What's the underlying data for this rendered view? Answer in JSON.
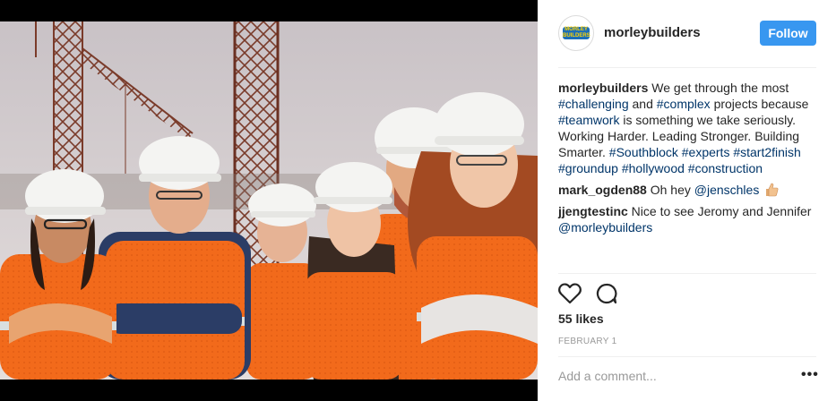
{
  "account": {
    "handle": "morleybuilders",
    "logo_text": "MORLEY BUILDERS"
  },
  "header": {
    "follow_label": "Follow"
  },
  "caption": {
    "user": "morleybuilders",
    "segments": [
      {
        "text": " We get through the most ",
        "type": "text"
      },
      {
        "text": "#challenging",
        "type": "tag"
      },
      {
        "text": " and ",
        "type": "text"
      },
      {
        "text": "#complex",
        "type": "tag"
      },
      {
        "text": " projects because ",
        "type": "text"
      },
      {
        "text": "#teamwork",
        "type": "tag"
      },
      {
        "text": " is something we take seriously.",
        "type": "text"
      },
      {
        "text": "\n",
        "type": "break"
      },
      {
        "text": "Working Harder. Leading Stronger. Building Smarter. ",
        "type": "text"
      },
      {
        "text": "#Southblock",
        "type": "tag"
      },
      {
        "text": " ",
        "type": "text"
      },
      {
        "text": "#experts",
        "type": "tag"
      },
      {
        "text": " ",
        "type": "text"
      },
      {
        "text": "#start2finish",
        "type": "tag"
      },
      {
        "text": " ",
        "type": "text"
      },
      {
        "text": "#groundup",
        "type": "tag"
      },
      {
        "text": " ",
        "type": "text"
      },
      {
        "text": "#hollywood",
        "type": "tag"
      },
      {
        "text": " ",
        "type": "text"
      },
      {
        "text": "#construction",
        "type": "tag"
      }
    ]
  },
  "comments": [
    {
      "user": "mark_ogden88",
      "pre": " Oh hey ",
      "mention": "@jenschles",
      "post": "",
      "emoji": "thumbs-up-icon"
    },
    {
      "user": "jjengtestinc",
      "pre": " Nice to see Jeromy and Jennifer ",
      "mention": "@morleybuilders",
      "post": "",
      "emoji": ""
    }
  ],
  "stats": {
    "likes": "55 likes",
    "date": "FEBRUARY 1"
  },
  "comment_box": {
    "placeholder": "Add a comment...",
    "more_label": "•••"
  },
  "icons": {
    "like": "heart-icon",
    "comment": "comment-bubble-icon",
    "more": "more-options-icon"
  },
  "colors": {
    "follow_button": "#3897f0",
    "hashtag": "#003569",
    "vest": "#f26a1b",
    "hardhat": "#f4f4f2"
  }
}
